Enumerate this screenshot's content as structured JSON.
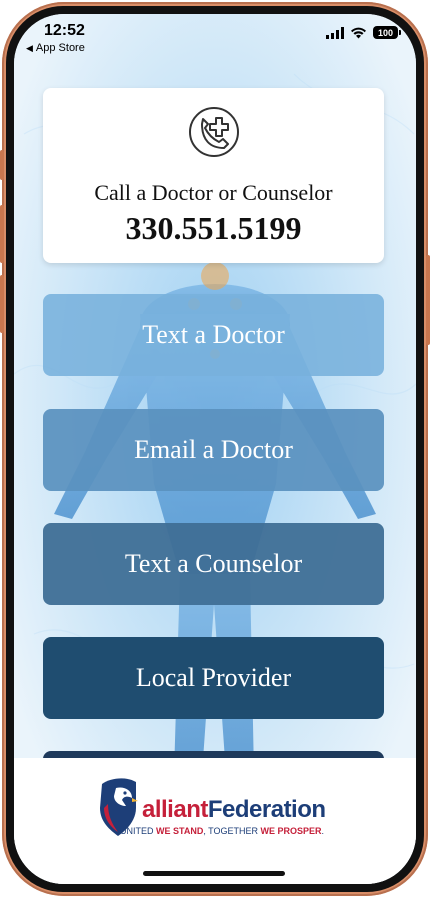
{
  "status_bar": {
    "time": "12:52",
    "back_label": "App Store",
    "battery": "100"
  },
  "call_card": {
    "title": "Call a Doctor or Counselor",
    "phone": "330.551.5199",
    "icon": "phone-medical-cross-icon"
  },
  "buttons": [
    {
      "label": "Text a Doctor"
    },
    {
      "label": "Email a Doctor"
    },
    {
      "label": "Text a Counselor"
    },
    {
      "label": "Local Provider"
    }
  ],
  "footer": {
    "logo_part1": "alliant",
    "logo_part2": "Federation",
    "tagline_1": "UNITED ",
    "tagline_2": "WE STAND",
    "tagline_3": ", TOGETHER ",
    "tagline_4": "WE PROSPER",
    "tagline_5": "."
  },
  "colors": {
    "btn1": "#78b0dc",
    "btn2": "#5a91be",
    "btn3": "#3f6f96",
    "btn4": "#1f4d70",
    "brand_red": "#c5203a",
    "brand_navy": "#1d3e78"
  }
}
